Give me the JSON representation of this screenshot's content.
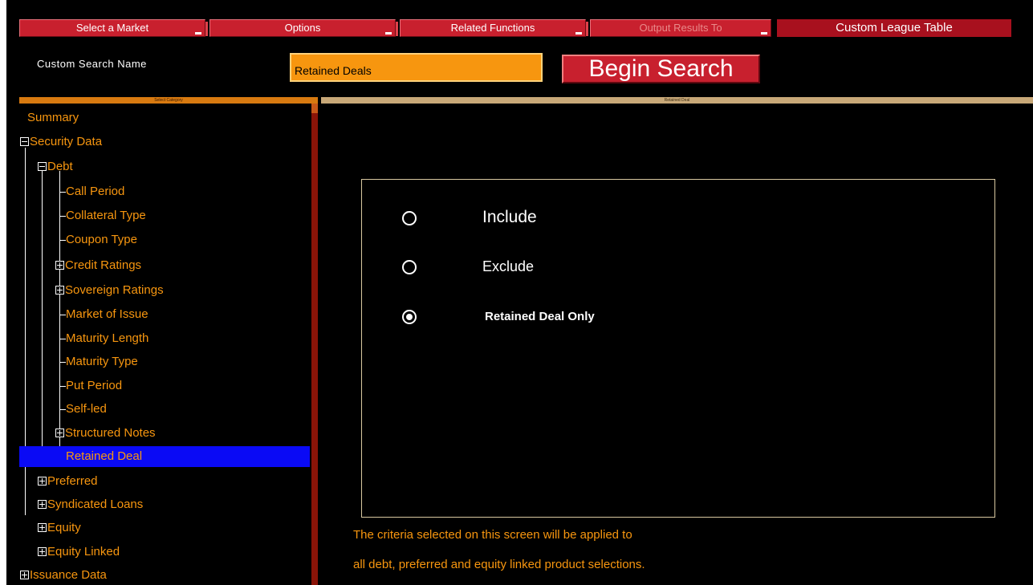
{
  "menu": {
    "items": [
      {
        "label": "Select a Market",
        "enabled": true
      },
      {
        "label": "Options",
        "enabled": true
      },
      {
        "label": "Related Functions",
        "enabled": true
      },
      {
        "label": "Output Results To",
        "enabled": false
      }
    ],
    "league_table": "Custom League Table"
  },
  "search": {
    "label": "Custom Search Name",
    "value": "Retained Deals",
    "begin_button": "Begin Search"
  },
  "left_panel": {
    "header": "Select Category"
  },
  "tree": [
    {
      "label": "Summary",
      "toggle": "none"
    },
    {
      "label": "Security Data",
      "toggle": "minus"
    },
    {
      "label": "Debt",
      "toggle": "minus"
    },
    {
      "label": "Call Period",
      "toggle": "none"
    },
    {
      "label": "Collateral Type",
      "toggle": "none"
    },
    {
      "label": "Coupon Type",
      "toggle": "none"
    },
    {
      "label": "Credit Ratings",
      "toggle": "plus"
    },
    {
      "label": "Sovereign Ratings",
      "toggle": "plus"
    },
    {
      "label": "Market of Issue",
      "toggle": "none"
    },
    {
      "label": "Maturity Length",
      "toggle": "none"
    },
    {
      "label": "Maturity Type",
      "toggle": "none"
    },
    {
      "label": "Put Period",
      "toggle": "none"
    },
    {
      "label": "Self-led",
      "toggle": "none"
    },
    {
      "label": "Structured Notes",
      "toggle": "plus"
    },
    {
      "label": "Retained Deal",
      "toggle": "none",
      "selected": true
    },
    {
      "label": "Preferred",
      "toggle": "plus"
    },
    {
      "label": "Syndicated Loans",
      "toggle": "plus"
    },
    {
      "label": "Equity",
      "toggle": "plus"
    },
    {
      "label": "Equity Linked",
      "toggle": "plus"
    },
    {
      "label": "Issuance Data",
      "toggle": "plus"
    }
  ],
  "right_panel": {
    "header": "Retained Deal",
    "options": [
      {
        "label": "Include",
        "checked": false
      },
      {
        "label": "Exclude",
        "checked": false
      },
      {
        "label": "Retained Deal Only",
        "checked": true
      }
    ],
    "note_lines": [
      "The criteria selected on this screen will be applied to",
      "all debt, preferred and equity linked product selections."
    ]
  },
  "colors": {
    "background": "#000000",
    "menu_red": "#c8202e",
    "tree_orange": "#f7960f",
    "selection_blue": "#0a0af5",
    "input_orange": "#f7960f"
  }
}
